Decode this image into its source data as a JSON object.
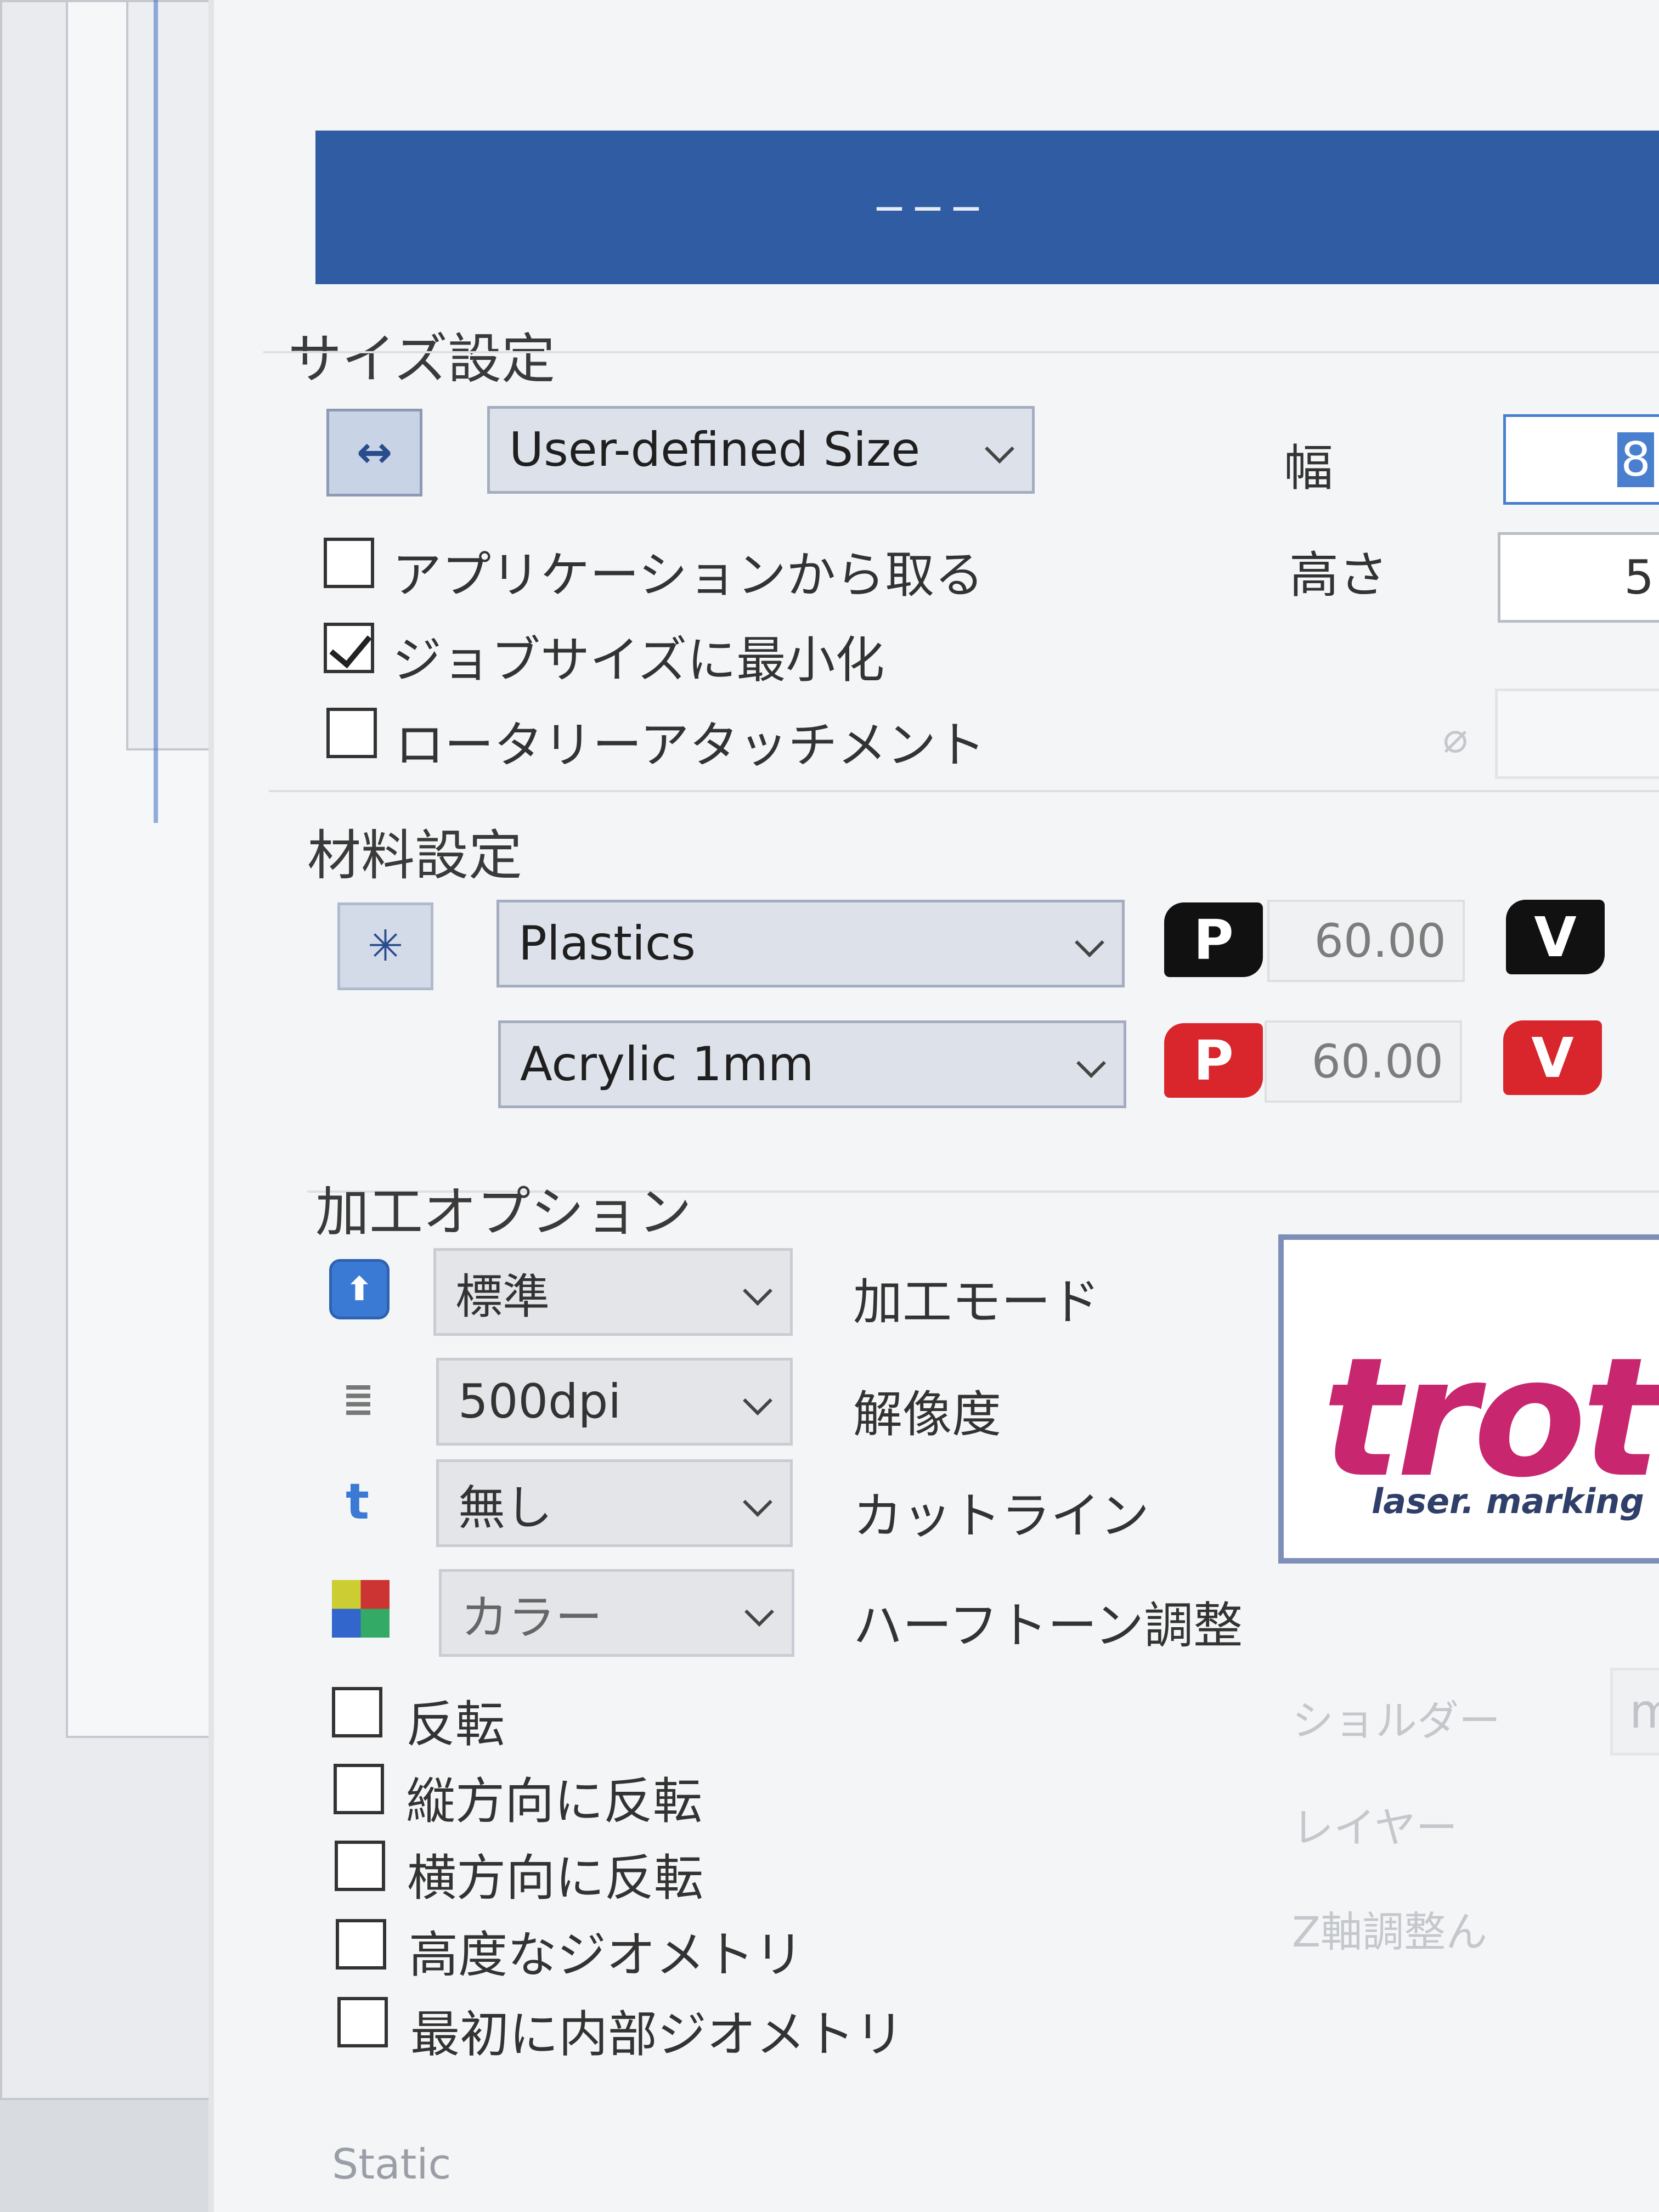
{
  "banner": {
    "text": "———"
  },
  "size": {
    "title": "サイズ設定",
    "dropdown_value": "User-defined Size",
    "width_label": "幅",
    "width_value": "8",
    "height_label": "高さ",
    "height_value": "5",
    "diameter_symbol": "⌀",
    "checks": [
      {
        "label": "アプリケーションから取る",
        "checked": false
      },
      {
        "label": "ジョブサイズに最小化",
        "checked": true
      },
      {
        "label": "ロータリーアタッチメント",
        "checked": false
      }
    ]
  },
  "material": {
    "title": "材料設定",
    "type": "Plastics",
    "subtype": "Acrylic 1mm",
    "p_label": "P",
    "v_label": "V",
    "p_value_1": "60.00",
    "p_value_2": "60.00"
  },
  "processing": {
    "title": "加工オプション",
    "rows": [
      {
        "value": "標準",
        "label": "加工モード"
      },
      {
        "value": "500dpi",
        "label": "解像度"
      },
      {
        "value": "無し",
        "label": "カットライン"
      },
      {
        "value": "カラー",
        "label": "ハーフトーン調整"
      }
    ],
    "icon_t": "t",
    "checks": [
      {
        "label": "反転",
        "checked": false
      },
      {
        "label": "縦方向に反転",
        "checked": false
      },
      {
        "label": "横方向に反転",
        "checked": false
      },
      {
        "label": "高度なジオメトリ",
        "checked": false
      },
      {
        "label": "最初に内部ジオメトリ",
        "checked": false
      }
    ],
    "disabled_labels": [
      "ショルダー",
      "レイヤー",
      "Z軸調整ん"
    ],
    "disabled_value": "m"
  },
  "preview": {
    "logo": "trot",
    "tagline": "laser. marking"
  },
  "footer": {
    "static": "Static"
  },
  "colors": {
    "banner": "#2f5ca3",
    "accent_red": "#d8262c",
    "logo": "#c8266f"
  }
}
